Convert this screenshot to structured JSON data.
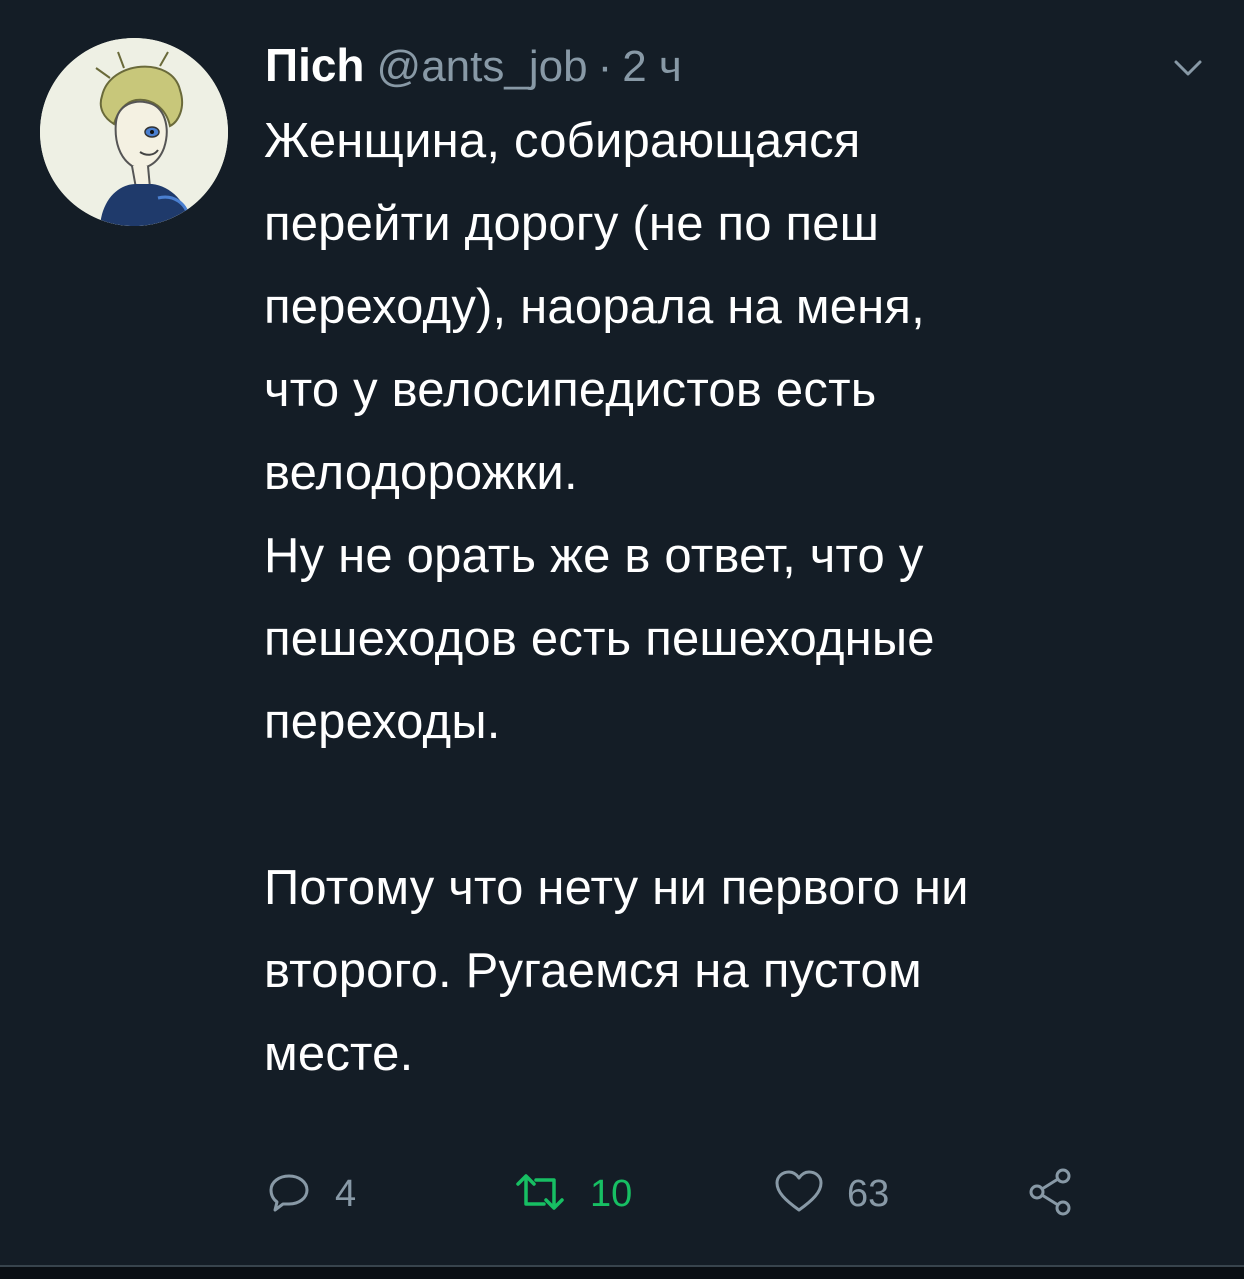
{
  "tweet": {
    "display_name": "Пісh",
    "handle": "@ants_job",
    "separator": "·",
    "timestamp": "2 ч",
    "text": "Женщина, собирающаяся\nперейти дорогу (не по пеш\nпереходу), наорала на меня,\nчто у велосипедистов есть\nвелодорожки.\nНу не орать же в ответ, что у\nпешеходов есть пешеходные\nпереходы.\n\nПотому что нету ни первого ни\nвторого. Ругаемся на пустом\nместе.",
    "reply_count": "4",
    "retweet_count": "10",
    "like_count": "63"
  },
  "icons": {
    "reply": "reply-icon",
    "retweet": "retweet-icon",
    "like": "heart-icon",
    "share": "share-icon",
    "menu": "chevron-down-icon"
  },
  "colors": {
    "background": "#141d26",
    "text": "#ffffff",
    "secondary": "#8899a6",
    "retweet_active": "#17bf63"
  }
}
